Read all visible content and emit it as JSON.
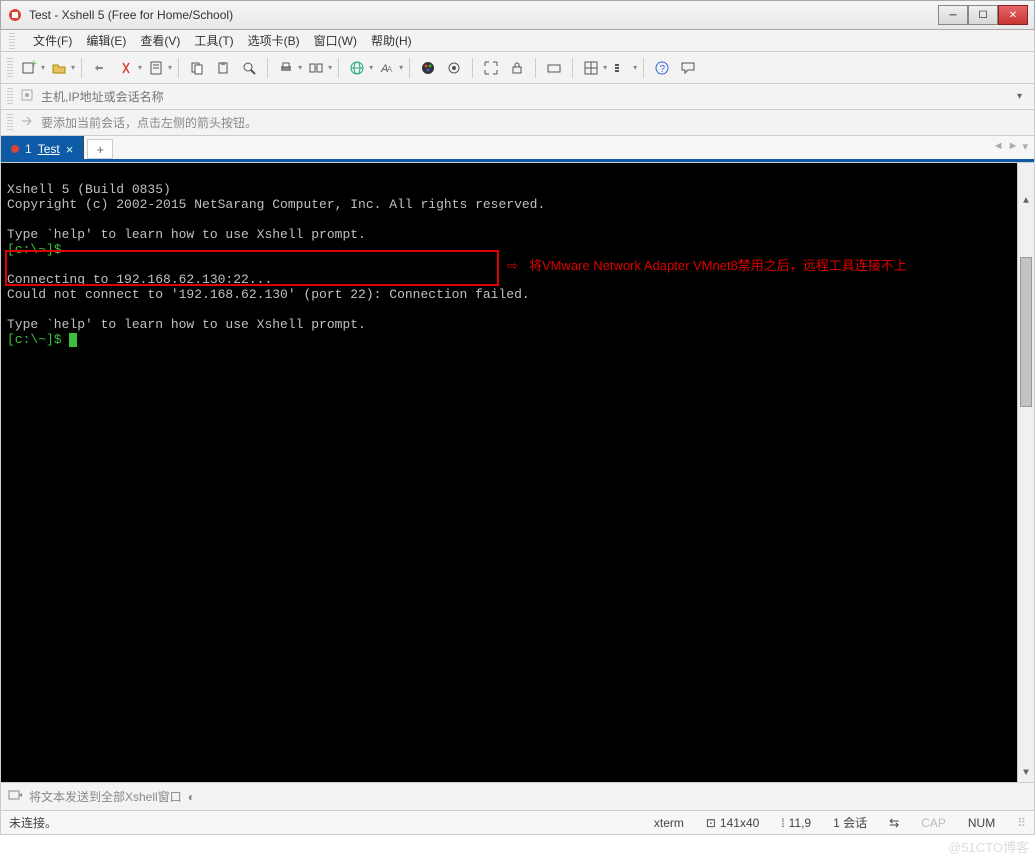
{
  "window": {
    "title": "Test - Xshell 5 (Free for Home/School)"
  },
  "menu": {
    "file": "文件(F)",
    "edit": "编辑(E)",
    "view": "查看(V)",
    "tools": "工具(T)",
    "tabs": "选项卡(B)",
    "window": "窗口(W)",
    "help": "帮助(H)"
  },
  "address": {
    "placeholder": "主机,IP地址或会话名称"
  },
  "hint": {
    "text": "要添加当前会话，点击左侧的箭头按钮。"
  },
  "tabs": {
    "active": {
      "num": "1",
      "name": "Test"
    }
  },
  "term": {
    "l1": "Xshell 5 (Build 0835)",
    "l2": "Copyright (c) 2002-2015 NetSarang Computer, Inc. All rights reserved.",
    "l3": "Type `help' to learn how to use Xshell prompt.",
    "prompt1": "[c:\\~]$",
    "l5": "Connecting to 192.168.62.130:22...",
    "l6": "Could not connect to '192.168.62.130' (port 22): Connection failed.",
    "l7": "Type `help' to learn how to use Xshell prompt.",
    "prompt2": "[c:\\~]$",
    "annotation_arrow": "⇨",
    "annotation": "将VMware Network Adapter VMnet8禁用之后，远程工具连接不上"
  },
  "sendbar": {
    "text": "将文本发送到全部Xshell窗口"
  },
  "status": {
    "conn": "未连接。",
    "termtype": "xterm",
    "size": "141x40",
    "cursor": "11,9",
    "sessions": "1 会话",
    "caps": "CAP",
    "num": "NUM"
  },
  "watermark": "@51CTO博客"
}
